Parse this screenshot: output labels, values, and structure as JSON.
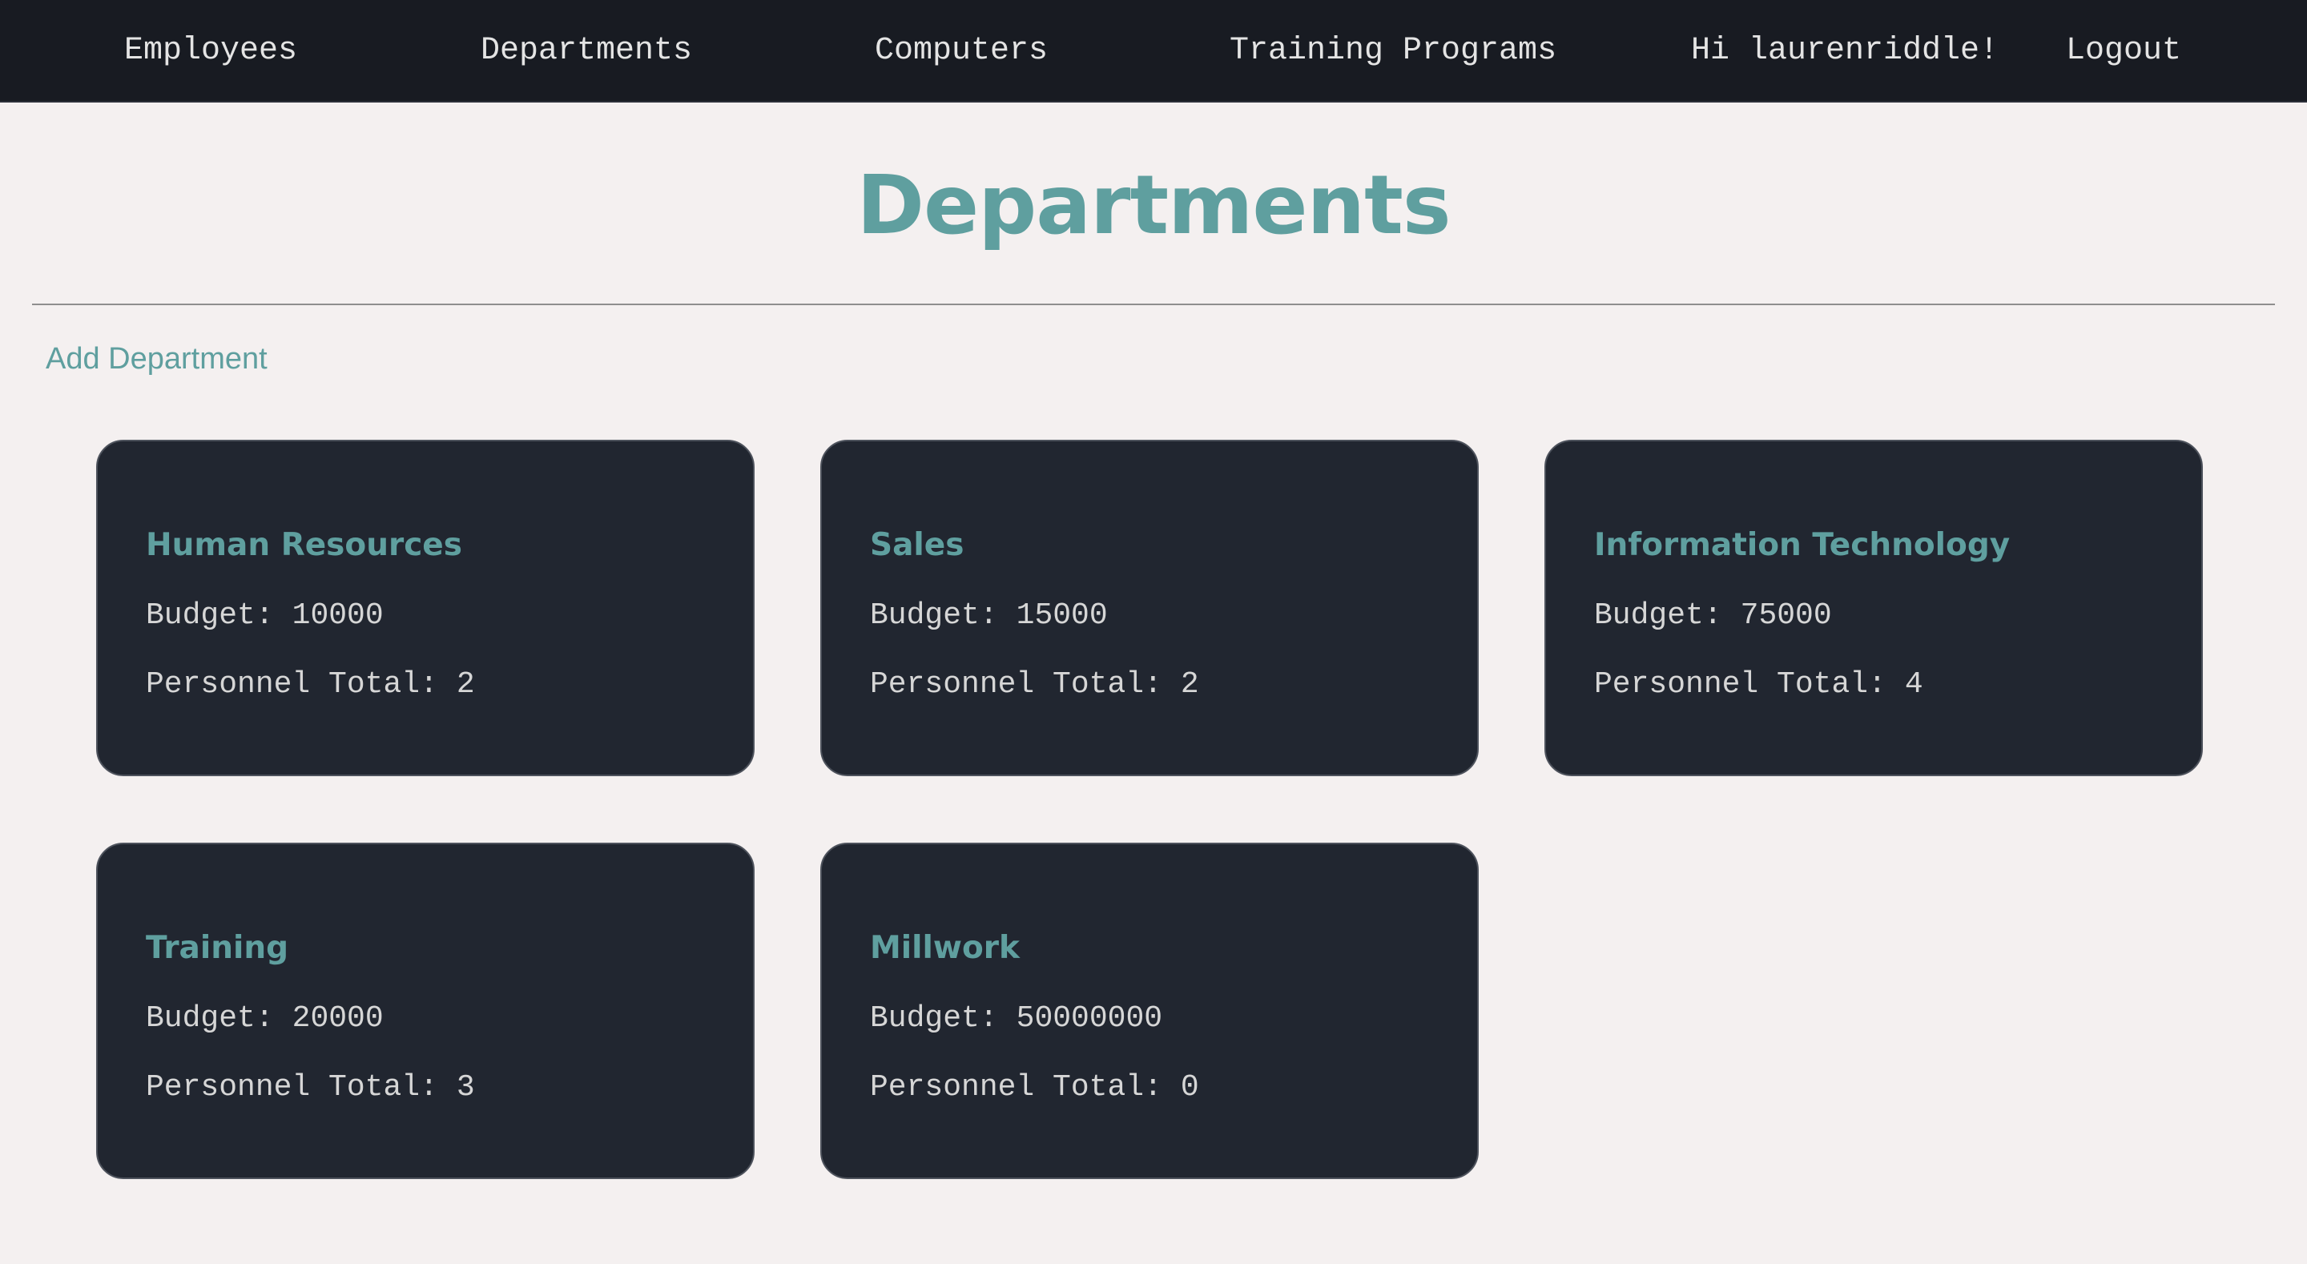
{
  "nav": {
    "employees": "Employees",
    "departments": "Departments",
    "computers": "Computers",
    "training_programs": "Training Programs",
    "greeting": "Hi laurenriddle!",
    "logout": "Logout"
  },
  "page": {
    "title": "Departments",
    "add_link": "Add Department"
  },
  "labels": {
    "budget": "Budget:",
    "personnel": "Personnel Total:"
  },
  "departments": [
    {
      "name": "Human Resources",
      "budget": "10000",
      "personnel": "2"
    },
    {
      "name": "Sales",
      "budget": "15000",
      "personnel": "2"
    },
    {
      "name": "Information Technology",
      "budget": "75000",
      "personnel": "4"
    },
    {
      "name": "Training",
      "budget": "20000",
      "personnel": "3"
    },
    {
      "name": "Millwork",
      "budget": "50000000",
      "personnel": "0"
    }
  ],
  "colors": {
    "nav_bg": "#181b22",
    "page_bg": "#f4f0f0",
    "card_bg": "#212630",
    "accent": "#5f9f9f",
    "card_text": "#d6d6d6"
  }
}
